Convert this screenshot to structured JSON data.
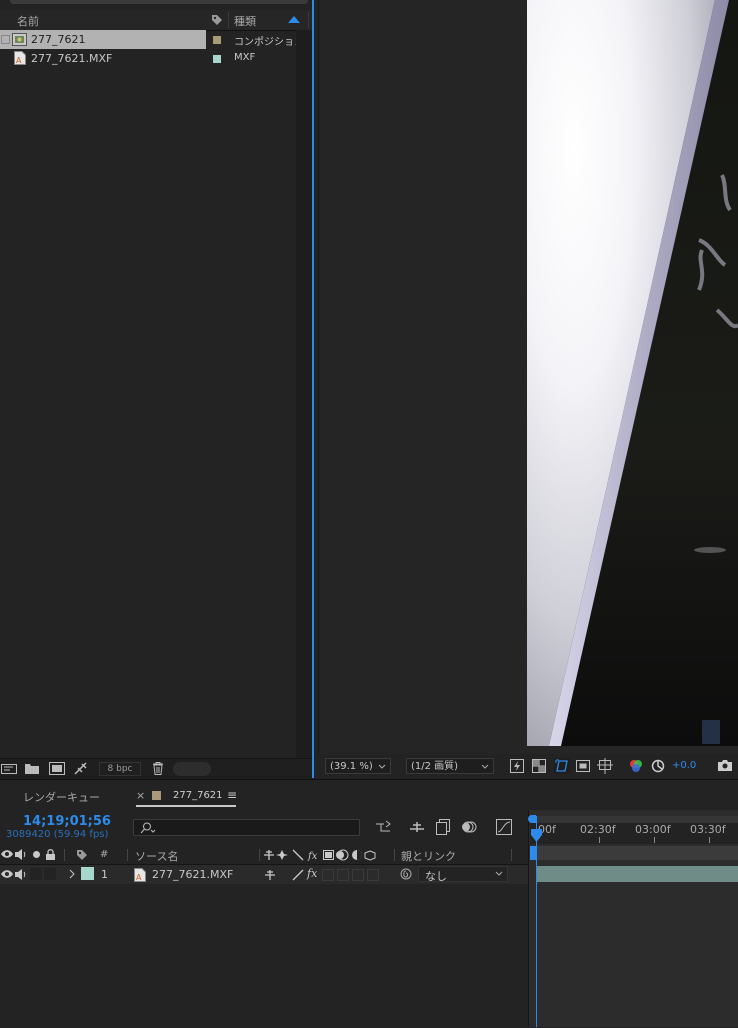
{
  "project": {
    "col_name": "名前",
    "col_type": "種類",
    "items": [
      {
        "name": "277_7621",
        "type": "コンポジション",
        "swatch": "#a89a7a",
        "selected": true,
        "icon": "composition-icon"
      },
      {
        "name": "277_7621.MXF",
        "type": "MXF",
        "swatch": "#a6d6cc",
        "selected": false,
        "icon": "footage-file-icon"
      }
    ],
    "bpc": "8 bpc"
  },
  "viewer": {
    "zoom": "(39.1 %)",
    "resolution": "(1/2 画質)",
    "exposure": "+0.0"
  },
  "timeline": {
    "render_queue_tab": "レンダーキュー",
    "comp_tab": "277_7621",
    "close_glyph": "×",
    "menu_glyph": "≡",
    "timecode": "14;19;01;56",
    "frame_info": "3089420 (59.94 fps)",
    "col_hash": "#",
    "col_source": "ソース名",
    "col_parent": "親とリンク",
    "ruler_labels": [
      "00f",
      "02:30f",
      "03:00f",
      "03:30f"
    ],
    "layer": {
      "number": "1",
      "name": "277_7621.MXF",
      "parent": "なし",
      "label_color": "#a6d6cc"
    }
  }
}
